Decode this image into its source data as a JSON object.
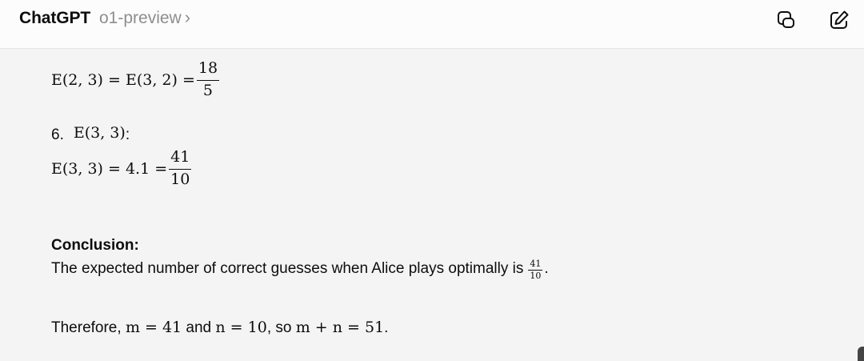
{
  "header": {
    "app_title": "ChatGPT",
    "model_label": "o1-preview",
    "model_chevron": "›"
  },
  "icons": {
    "copy": "copy-icon",
    "edit": "edit-icon"
  },
  "content": {
    "eq_prev": {
      "lhs": "E(2, 3) = E(3, 2) =",
      "num": "18",
      "den": "5"
    },
    "item6": {
      "number": "6.",
      "expr": "E(3, 3)",
      "colon": ":"
    },
    "eq6": {
      "lhs": "E(3, 3) = 4.1 =",
      "num": "41",
      "den": "10"
    },
    "conclusion": {
      "heading": "Conclusion:",
      "text": "The expected number of correct guesses when Alice plays optimally is",
      "num": "41",
      "den": "10",
      "end": "."
    },
    "therefore": {
      "prefix": "Therefore, ",
      "m_expr": "m = 41",
      "and_word": " and ",
      "n_expr": "n = 10",
      "so_word": ", so ",
      "sum_expr": "m + n = 51",
      "end": "."
    }
  },
  "colors": {
    "background": "#f4f4f4",
    "topbar": "#fcfcfc",
    "text": "#0d0d0d",
    "muted": "#8e8e8e"
  }
}
